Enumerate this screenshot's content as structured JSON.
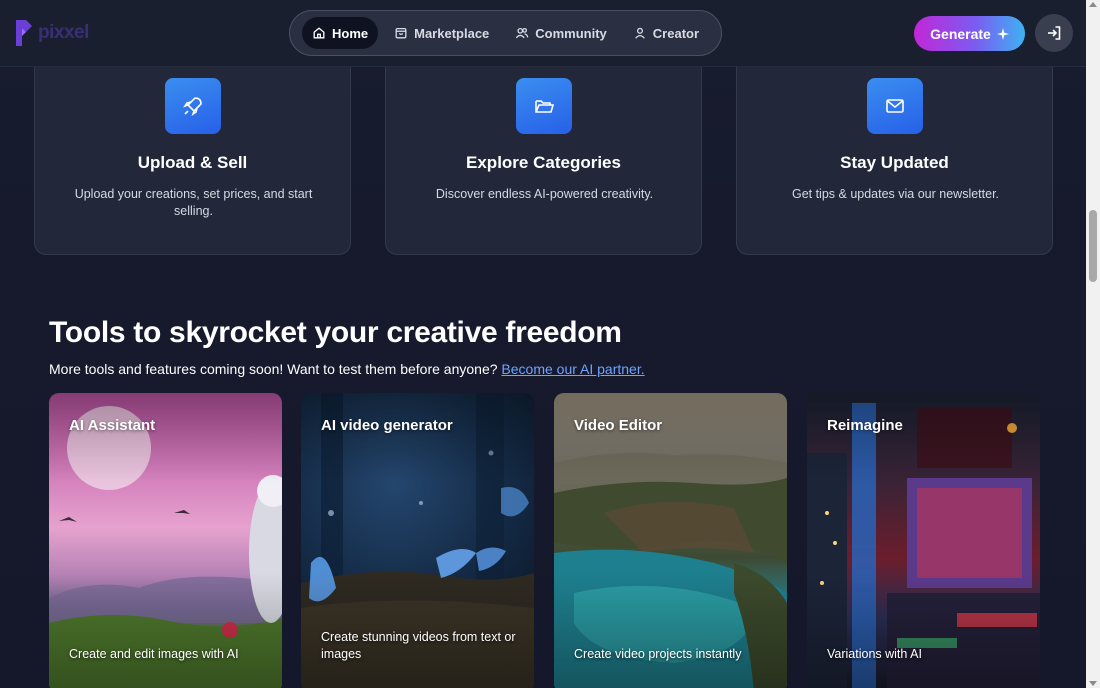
{
  "app": {
    "logo_text": "pixxel"
  },
  "nav": {
    "items": [
      {
        "label": "Home",
        "icon": "home-icon",
        "active": true
      },
      {
        "label": "Marketplace",
        "icon": "bag-icon",
        "active": false
      },
      {
        "label": "Community",
        "icon": "users-icon",
        "active": false
      },
      {
        "label": "Creator",
        "icon": "user-icon",
        "active": false
      }
    ]
  },
  "header": {
    "generate_label": "Generate",
    "generate_icon": "sparkle-icon",
    "login_icon": "login-icon"
  },
  "features": [
    {
      "title": "Upload & Sell",
      "description": "Upload your creations, set prices, and start selling.",
      "icon": "rocket-icon"
    },
    {
      "title": "Explore Categories",
      "description": "Discover endless AI-powered creativity.",
      "icon": "folder-icon"
    },
    {
      "title": "Stay Updated",
      "description": "Get tips & updates via our newsletter.",
      "icon": "mail-icon"
    }
  ],
  "tools_section": {
    "title": "Tools to skyrocket your creative freedom",
    "subtitle": "More tools and features coming soon! Want to test them before anyone?",
    "link_text": "Become our AI partner."
  },
  "tools": [
    {
      "title": "AI Assistant",
      "description": "Create and edit images with AI"
    },
    {
      "title": "AI video generator",
      "description": "Create stunning videos from text or images"
    },
    {
      "title": "Video Editor",
      "description": "Create video projects instantly"
    },
    {
      "title": "Reimagine",
      "description": "Variations with AI"
    }
  ],
  "colors": {
    "background": "#161a2c",
    "card": "#22283a",
    "accent_blue": "#2f78ee",
    "generate_gradient_start": "#c227d8",
    "generate_gradient_end": "#3fb1f3",
    "link": "#6fa4ff"
  }
}
